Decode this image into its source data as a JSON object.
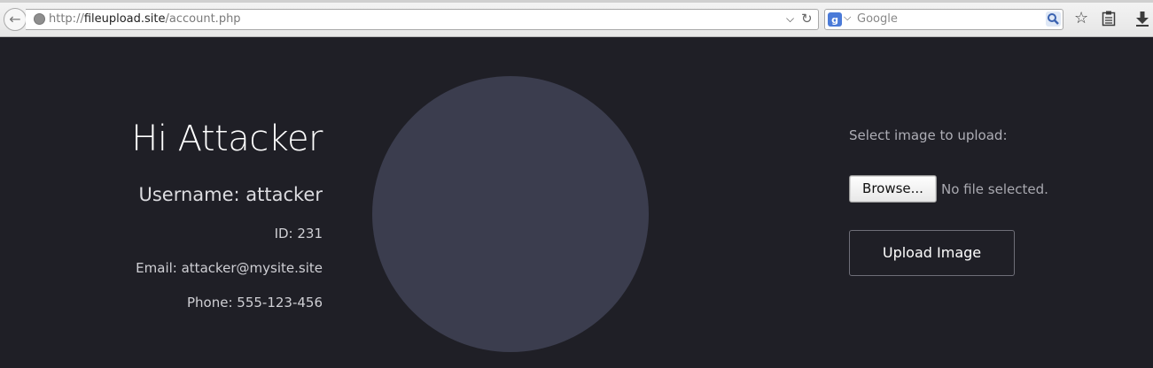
{
  "browser": {
    "url_prefix": "http://",
    "url_host": "fileupload.site",
    "url_path": "/account.php",
    "search_placeholder": "Google",
    "search_engine_letter": "g",
    "icons": [
      "back-arrow-icon",
      "globe-icon",
      "chevron-down-icon",
      "reload-icon",
      "google-icon",
      "search-icon",
      "star-icon",
      "clipboard-icon",
      "download-icon"
    ]
  },
  "profile": {
    "greeting": "Hi Attacker",
    "username": "Username: attacker",
    "id": "ID: 231",
    "email": "Email: attacker@mysite.site",
    "phone": "Phone: 555-123-456"
  },
  "upload": {
    "label": "Select image to upload:",
    "browse_label": "Browse...",
    "file_status": "No file selected.",
    "submit_label": "Upload Image"
  },
  "colors": {
    "page_background": "#1f1f26",
    "avatar_fill": "#3b3d4e",
    "toolbar_background": "#ececec"
  }
}
